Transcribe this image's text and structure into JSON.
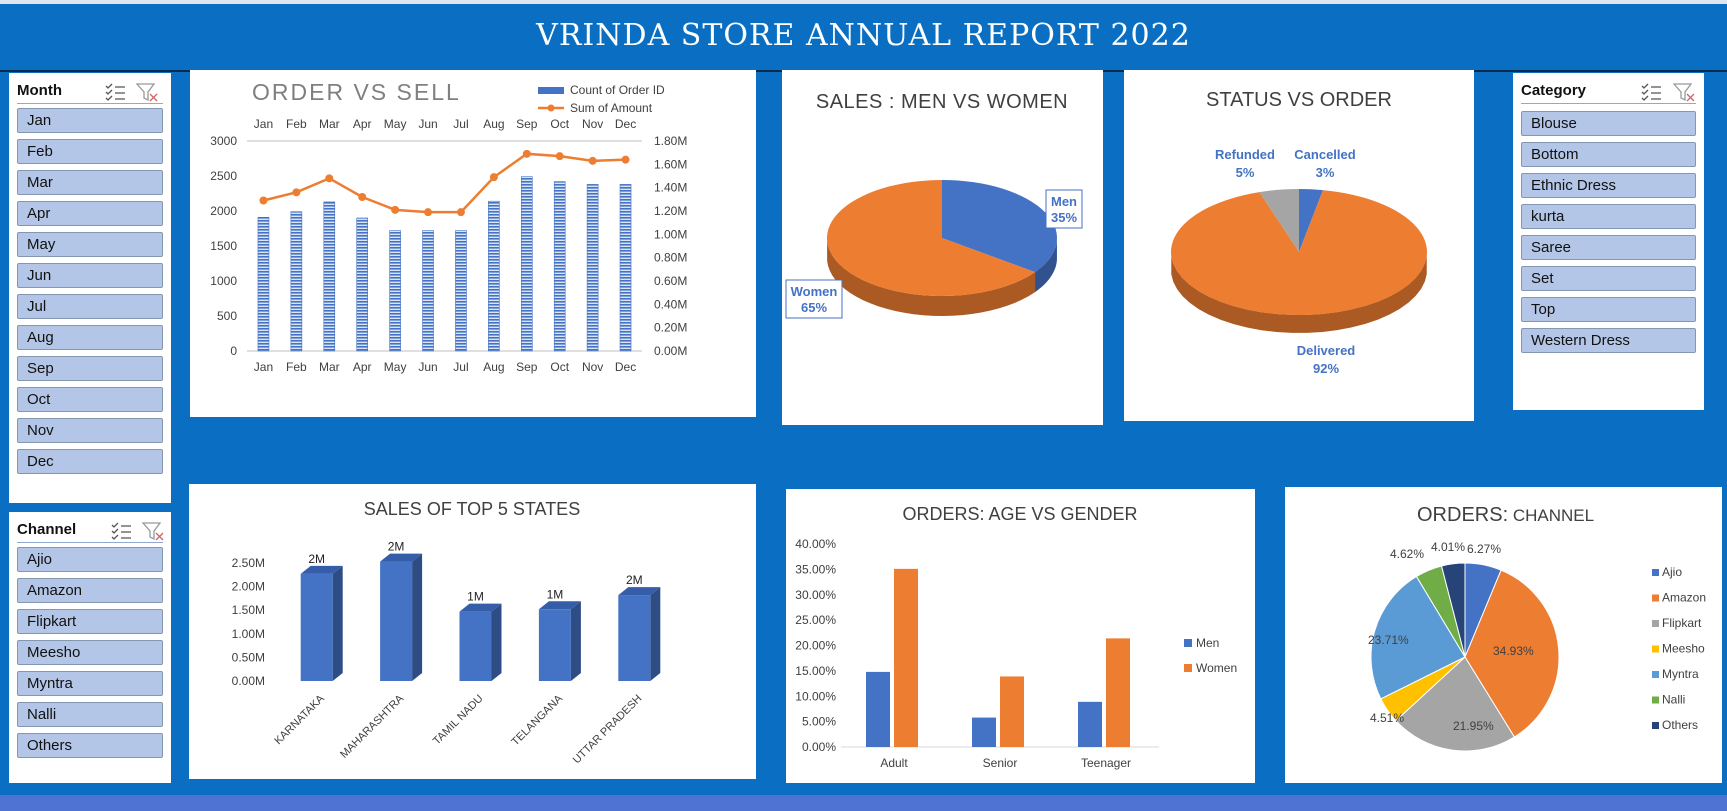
{
  "report": {
    "title": "VRINDA STORE ANNUAL REPORT 2022"
  },
  "colors": {
    "background": "#0a6fc2",
    "blue": "#4472c4",
    "orange": "#ed7d31",
    "gray": "#a5a5a5",
    "yellow": "#ffc000",
    "lightblue": "#5b9bd5",
    "green": "#70ad47",
    "navy": "#264478"
  },
  "slicers": {
    "month": {
      "title": "Month",
      "items": [
        "Jan",
        "Feb",
        "Mar",
        "Apr",
        "May",
        "Jun",
        "Jul",
        "Aug",
        "Sep",
        "Oct",
        "Nov",
        "Dec"
      ]
    },
    "channel": {
      "title": "Channel",
      "items": [
        "Ajio",
        "Amazon",
        "Flipkart",
        "Meesho",
        "Myntra",
        "Nalli",
        "Others"
      ]
    },
    "category": {
      "title": "Category",
      "items": [
        "Blouse",
        "Bottom",
        "Ethnic Dress",
        "kurta",
        "Saree",
        "Set",
        "Top",
        "Western Dress"
      ]
    }
  },
  "chart_data": [
    {
      "id": "order_vs_sell",
      "type": "bar",
      "title": "ORDER VS SELL",
      "categories": [
        "Jan",
        "Feb",
        "Mar",
        "Apr",
        "May",
        "Jun",
        "Jul",
        "Aug",
        "Sep",
        "Oct",
        "Nov",
        "Dec"
      ],
      "series": [
        {
          "name": "Count of Order ID",
          "type": "bar",
          "axis": "left",
          "values": [
            1910,
            1990,
            2130,
            1900,
            1720,
            1720,
            1720,
            2140,
            2490,
            2420,
            2380,
            2380
          ]
        },
        {
          "name": "Sum of Amount",
          "type": "line",
          "axis": "right",
          "values": [
            1.29,
            1.36,
            1.48,
            1.32,
            1.21,
            1.19,
            1.19,
            1.49,
            1.69,
            1.67,
            1.63,
            1.64
          ]
        }
      ],
      "ylim_left": [
        0,
        3000
      ],
      "yticks_left": [
        "0",
        "500",
        "1000",
        "1500",
        "2000",
        "2500",
        "3000"
      ],
      "ylim_right": [
        0,
        1.8
      ],
      "yticks_right": [
        "0.00M",
        "0.20M",
        "0.40M",
        "0.60M",
        "0.80M",
        "1.00M",
        "1.20M",
        "1.40M",
        "1.60M",
        "1.80M"
      ],
      "legend": "top-right"
    },
    {
      "id": "men_vs_women",
      "type": "pie",
      "title": "SALES : MEN VS WOMEN",
      "labels": [
        "Men",
        "Women"
      ],
      "values": [
        35,
        65
      ],
      "value_labels": [
        "35%",
        "65%"
      ]
    },
    {
      "id": "status_vs_order",
      "type": "pie",
      "title": "STATUS VS ORDER",
      "labels": [
        "Cancelled",
        "Delivered",
        "Refunded"
      ],
      "values": [
        3,
        92,
        5
      ],
      "value_labels": [
        "3%",
        "92%",
        "5%"
      ]
    },
    {
      "id": "top5_states",
      "type": "bar",
      "title": "SALES OF TOP 5 STATES",
      "categories": [
        "KARNATAKA",
        "MAHARASHTRA",
        "TAMIL NADU",
        "TELANGANA",
        "UTTAR PRADESH"
      ],
      "values": [
        2.27,
        2.53,
        1.47,
        1.52,
        1.82
      ],
      "data_labels": [
        "2M",
        "2M",
        "1M",
        "1M",
        "2M"
      ],
      "ylim": [
        0,
        2.5
      ],
      "yticks": [
        "0.00M",
        "0.50M",
        "1.00M",
        "1.50M",
        "2.00M",
        "2.50M"
      ]
    },
    {
      "id": "age_vs_gender",
      "type": "bar",
      "title": "ORDERS: AGE VS GENDER",
      "categories": [
        "Adult",
        "Senior",
        "Teenager"
      ],
      "series": [
        {
          "name": "Men",
          "values": [
            14.8,
            5.8,
            8.9
          ]
        },
        {
          "name": "Women",
          "values": [
            35.1,
            13.9,
            21.4
          ]
        }
      ],
      "ylim": [
        0,
        40
      ],
      "yticks": [
        "0.00%",
        "5.00%",
        "10.00%",
        "15.00%",
        "20.00%",
        "25.00%",
        "30.00%",
        "35.00%",
        "40.00%"
      ],
      "legend": "right"
    },
    {
      "id": "orders_channel",
      "type": "pie",
      "title_bold": "ORDERS:",
      "title_rest": " CHANNEL",
      "labels": [
        "Ajio",
        "Amazon",
        "Flipkart",
        "Meesho",
        "Myntra",
        "Nalli",
        "Others"
      ],
      "values": [
        6.27,
        34.93,
        21.95,
        4.51,
        23.71,
        4.62,
        4.01
      ],
      "value_labels": [
        "6.27%",
        "34.93%",
        "21.95%",
        "4.51%",
        "23.71%",
        "4.62%",
        "4.01%"
      ],
      "legend": "right"
    }
  ]
}
